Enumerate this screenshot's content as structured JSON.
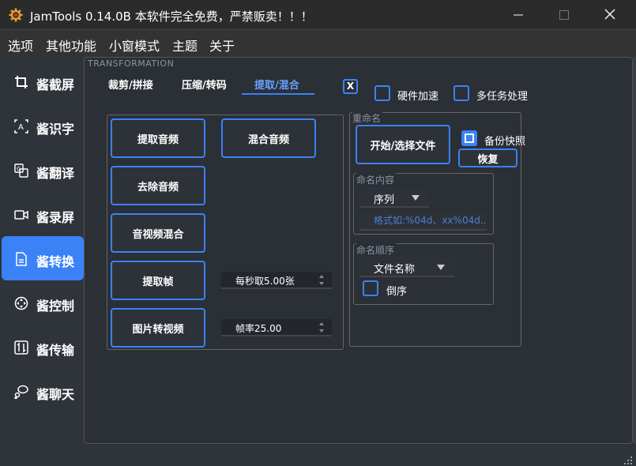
{
  "window": {
    "title": "JamTools 0.14.0B  本软件完全免费，严禁贩卖！！！"
  },
  "menu": {
    "items": [
      "选项",
      "其他功能",
      "小窗模式",
      "主题",
      "关于"
    ]
  },
  "sidebar": {
    "items": [
      {
        "label": "酱截屏",
        "icon": "crop-icon"
      },
      {
        "label": "酱识字",
        "icon": "text-scan-icon"
      },
      {
        "label": "酱翻译",
        "icon": "translate-icon"
      },
      {
        "label": "酱录屏",
        "icon": "video-camera-icon"
      },
      {
        "label": "酱转换",
        "icon": "convert-icon",
        "active": true
      },
      {
        "label": "酱控制",
        "icon": "control-icon"
      },
      {
        "label": "酱传输",
        "icon": "transfer-icon"
      },
      {
        "label": "酱聊天",
        "icon": "chat-icon"
      }
    ],
    "active_index": 4
  },
  "main": {
    "section_title": "TRANSFORMATION",
    "tabs": [
      {
        "label": "裁剪/拼接",
        "active": false
      },
      {
        "label": "压缩/转码",
        "active": false
      },
      {
        "label": "提取/混合",
        "active": true
      }
    ],
    "close_label": "X",
    "hardware_accel": {
      "label": "硬件加速",
      "checked": false
    },
    "multi_task": {
      "label": "多任务处理",
      "checked": false
    },
    "buttons": {
      "extract_audio": "提取音频",
      "mix_audio": "混合音频",
      "remove_audio": "去除音频",
      "av_mix": "音视频混合",
      "extract_frames": "提取帧",
      "images_to_video": "图片转视频"
    },
    "spin_fps_extract": "每秒取5.00张",
    "spin_framerate": "帧率25.00"
  },
  "rename": {
    "title": "重命名",
    "start_button": "开始/选择文件",
    "backup": {
      "label": "备份快照",
      "checked": true
    },
    "restore_button": "恢复",
    "content_group": {
      "title": "命名内容",
      "combo_value": "序列",
      "input_placeholder": "格式如:%04d、xx%04d..."
    },
    "order_group": {
      "title": "命名顺序",
      "combo_value": "文件名称",
      "reverse": {
        "label": "倒序",
        "checked": false
      }
    }
  },
  "colors": {
    "accent": "#3b82f6",
    "background": "#2d3138",
    "titlebar": "#2b2b2b"
  }
}
